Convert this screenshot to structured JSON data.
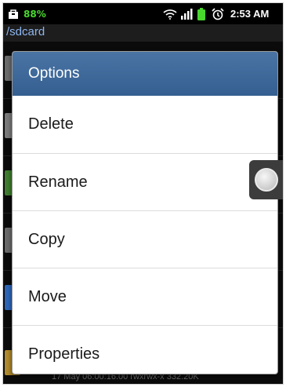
{
  "status_bar": {
    "battery_percent": "88%",
    "time": "2:53 AM",
    "icons": [
      "shopping-bag-icon",
      "wifi-icon",
      "signal-icon",
      "battery-icon",
      "alarm-icon"
    ]
  },
  "background": {
    "path": "/sdcard",
    "partial_meta": "17 May 06:00:16.00 rwxrwx-x 332.20K"
  },
  "dialog": {
    "title": "Options",
    "items": [
      "Delete",
      "Rename",
      "Copy",
      "Move",
      "Properties"
    ]
  },
  "colors": {
    "dialog_title_bg": "#3d6796",
    "status_green": "#49d82e",
    "path_text": "#8eb6ef"
  }
}
